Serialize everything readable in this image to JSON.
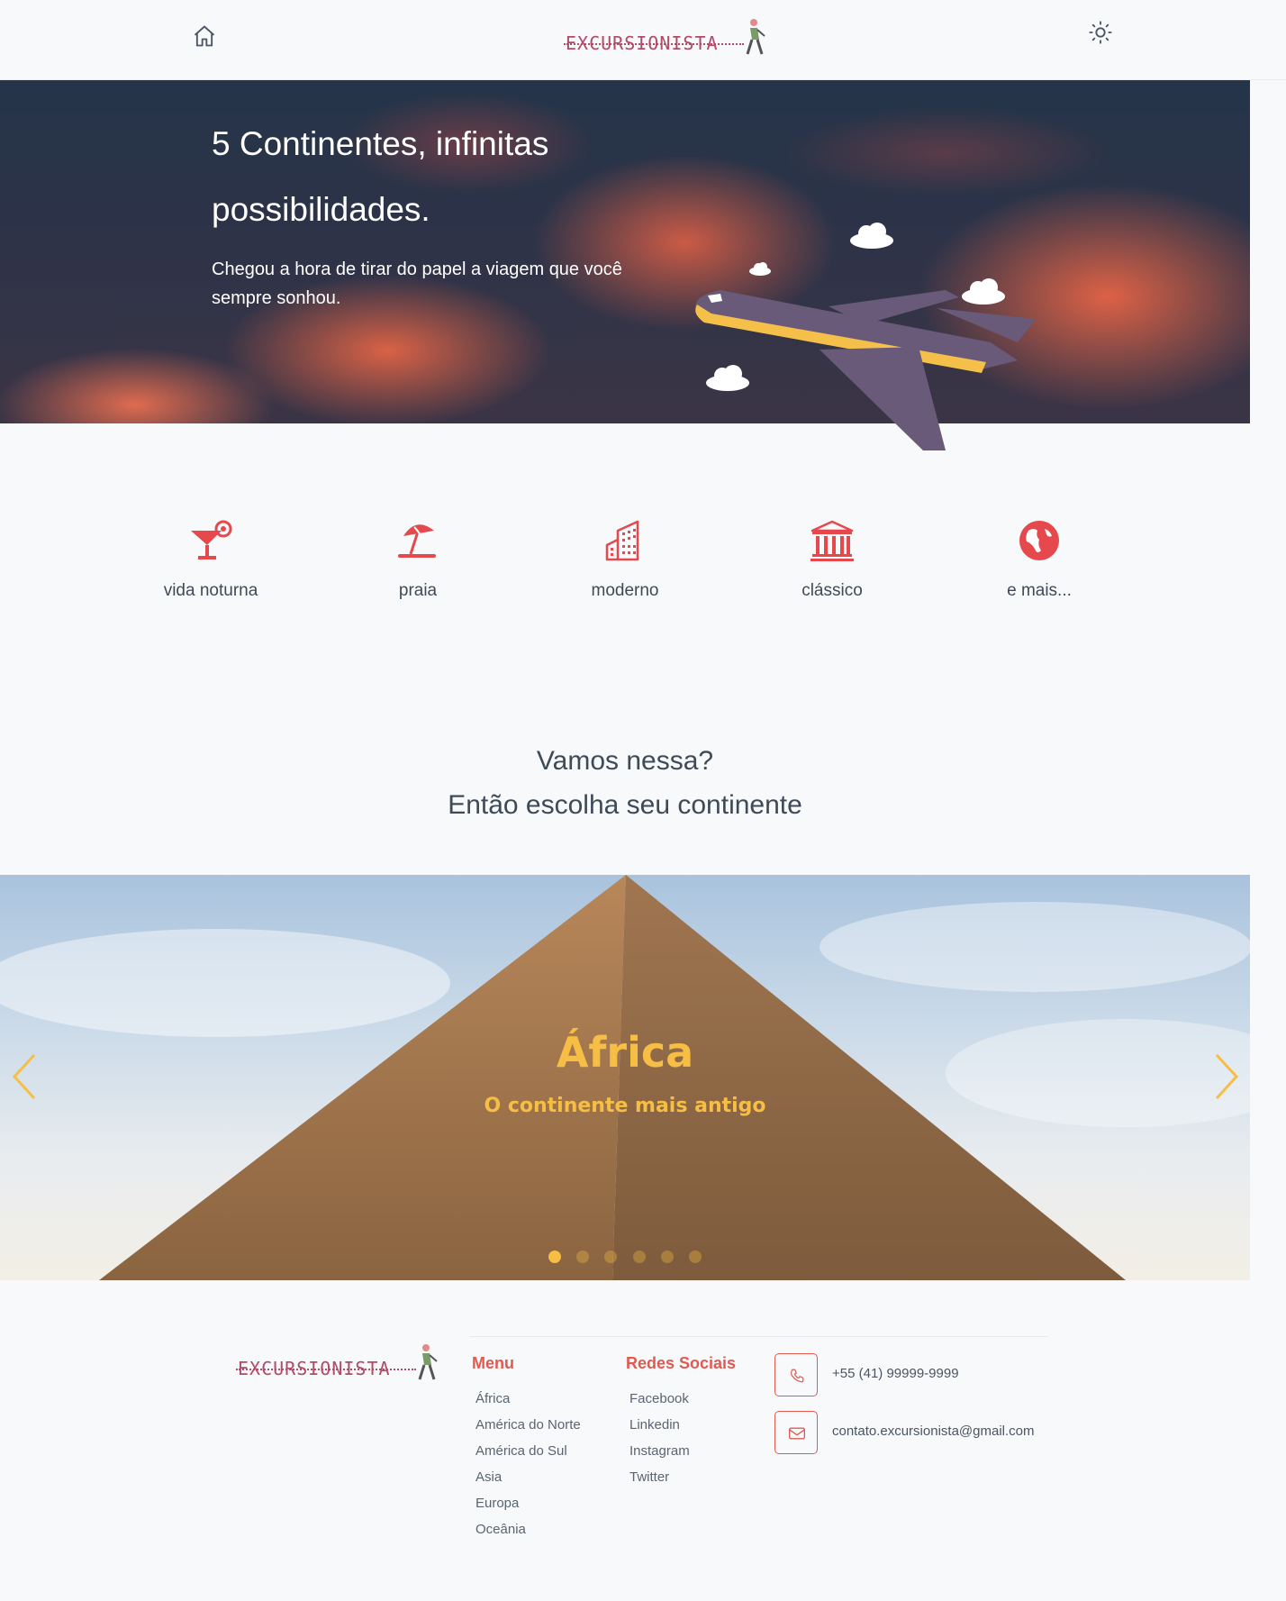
{
  "header": {
    "home_icon": "home-icon",
    "logo_text": "EXCURSIONISTA",
    "theme_icon": "sun-icon"
  },
  "hero": {
    "title": "5 Continentes, infinitas possibilidades.",
    "subtitle": "Chegou a hora de tirar do papel a viagem que você sempre sonhou."
  },
  "features": [
    {
      "label": "vida noturna",
      "icon": "cocktail-icon"
    },
    {
      "label": "praia",
      "icon": "beach-umbrella-icon"
    },
    {
      "label": "moderno",
      "icon": "building-icon"
    },
    {
      "label": "clássico",
      "icon": "classical-building-icon"
    },
    {
      "label": "e mais...",
      "icon": "globe-icon"
    }
  ],
  "section": {
    "line1": "Vamos nessa?",
    "line2": "Então escolha seu continente"
  },
  "carousel": {
    "title": "África",
    "subtitle": "O continente mais antigo",
    "active_slide": 1,
    "total_slides": 6
  },
  "footer": {
    "logo_text": "EXCURSIONISTA",
    "menu": {
      "title": "Menu",
      "items": [
        "África",
        "América do Norte",
        "América do Sul",
        "Asia",
        "Europa",
        "Oceânia"
      ]
    },
    "social": {
      "title": "Redes Sociais",
      "items": [
        "Facebook",
        "Linkedin",
        "Instagram",
        "Twitter"
      ]
    },
    "contact": {
      "phone": "+55 (41) 99999-9999",
      "email": "contato.excursionista@gmail.com"
    }
  },
  "colors": {
    "accent": "#e05a50",
    "yellow": "#f6be45",
    "text": "#3f4a59",
    "brand": "#b14b66"
  }
}
